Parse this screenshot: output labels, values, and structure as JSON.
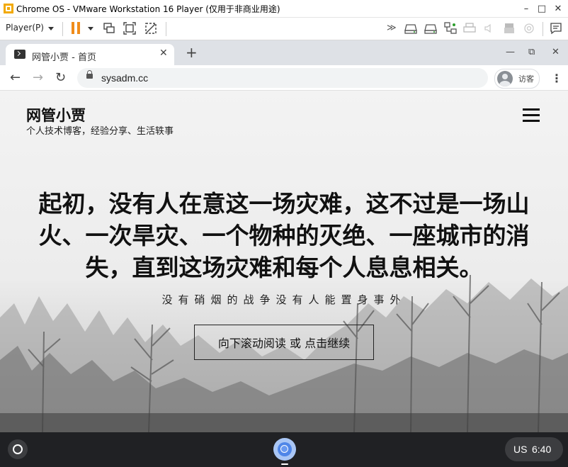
{
  "vm_window": {
    "title": "Chrome OS - VMware Workstation 16 Player (仅用于非商业用途)",
    "controls": {
      "minimize": "–",
      "maximize": "□",
      "close": "✕"
    }
  },
  "vm_toolbar": {
    "player_menu": "Player(P)",
    "icons": [
      "pause-icon",
      "dropdown-icon",
      "send-ctrl-alt-del-icon",
      "fit-guest-icon",
      "unity-icon",
      "more-icon",
      "hdd-icon",
      "hdd-icon-2",
      "network-icon",
      "printer-icon",
      "sound-icon",
      "usb-icon",
      "camera-icon",
      "message-icon"
    ]
  },
  "chrome": {
    "tab": {
      "title": "网管小贾 - 首页",
      "close": "✕"
    },
    "new_tab": "+",
    "window_controls": {
      "minimize": "—",
      "restore": "⧉",
      "close": "✕"
    },
    "nav": {
      "back": "←",
      "forward": "→",
      "reload": "↻"
    },
    "url": "sysadm.cc",
    "profile_label": "访客",
    "menu": "⋮"
  },
  "site": {
    "title": "网管小贾",
    "subtitle": "个人技术博客，经验分享、生活轶事",
    "headline": "起初，没有人在意这一场灾难，这不过是一场山火、一次旱灾、一个物种的灭绝、一座城市的消失，直到这场灾难和每个人息息相关。",
    "subline": "没有硝烟的战争没有人能置身事外",
    "cta": "向下滚动阅读 或 点击继续"
  },
  "shelf": {
    "ime": "US",
    "time": "6:40"
  }
}
